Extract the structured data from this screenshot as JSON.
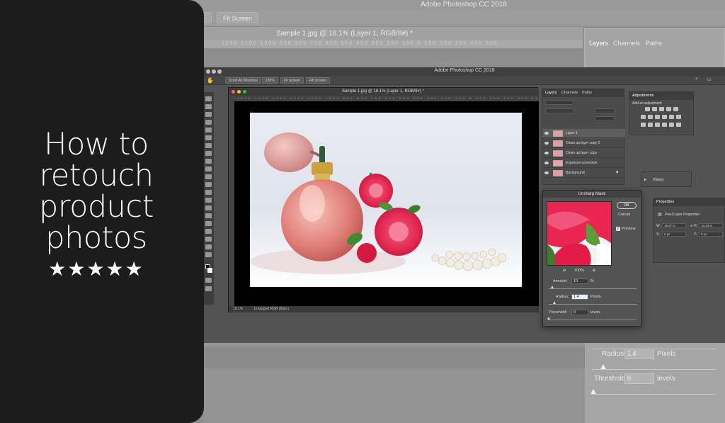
{
  "headline": {
    "lines": [
      "How to",
      "retouch",
      "product",
      "photos"
    ],
    "stars": "★★★★★"
  },
  "background": {
    "app_title": "Adobe Photoshop CC 2018",
    "fit_screen_label": "Fit Screen",
    "doc_tab_label": "Sample 1.jpg @ 18.1% (Layer 1, RGB/8#) *",
    "ruler_text": "1200 1100 1000 900 800 700 600 500 400 300 200 100 0 100 200 300 400 500",
    "layers_tab": "Layers",
    "channels_tab": "Channels",
    "paths_tab": "Paths",
    "radius_label": "Radius:",
    "radius_value": "1.4",
    "radius_unit": "Pixels",
    "threshold_label": "Threshold:",
    "threshold_value": "0",
    "threshold_unit": "levels"
  },
  "ps": {
    "title": "Adobe Photoshop CC 2018",
    "options": [
      "Scroll All Windows",
      "100%",
      "Fit Screen",
      "Fill Screen"
    ],
    "doc_tab": "Sample 1.jpg @ 18.1% (Layer 1, RGB/8#) *",
    "ruler": "1500 1400 1300 1200 1100 1000 900 800 700 600 500 400 300 200 100 0 100 200 300 400 500 600 700 800 900",
    "status_zoom": "18.1%",
    "status_text": "Untagged RGB (8bpc)"
  },
  "layers_panel": {
    "tabs": [
      "Layers",
      "Channels",
      "Paths"
    ],
    "items": [
      "Layer 1",
      "Clean up layer copy 2",
      "Clean up layer copy",
      "Exposure correction",
      "Background"
    ]
  },
  "adjustments": {
    "tab": "Adjustments",
    "heading": "Add an adjustment"
  },
  "history": {
    "label": "History"
  },
  "properties": {
    "tab": "Properties",
    "heading": "Pixel Layer Properties",
    "w_label": "W:",
    "w_value": "15.87 in",
    "h_label": "H:",
    "x_label": "X:",
    "x_value": "0 px",
    "y_label": "Y:",
    "y_value": "0 px",
    "h_value": "10.23 in"
  },
  "unsharp_mask": {
    "title": "Unsharp Mask",
    "ok": "OK",
    "cancel": "Cancel",
    "preview": "Preview",
    "zoom": "100%",
    "amount_label": "Amount:",
    "amount_value": "10",
    "amount_unit": "%",
    "radius_label": "Radius:",
    "radius_value": "1.4",
    "radius_unit": "Pixels",
    "threshold_label": "Threshold:",
    "threshold_value": "0",
    "threshold_unit": "levels"
  }
}
